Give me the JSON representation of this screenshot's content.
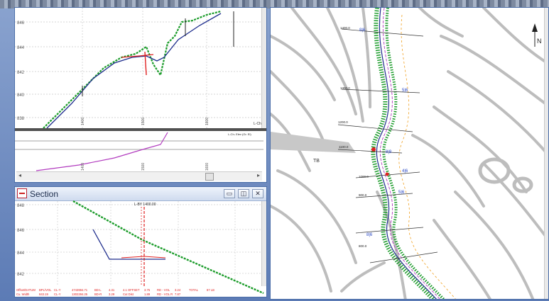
{
  "profile": {
    "elevation_ticks": [
      "846",
      "844",
      "842",
      "840",
      "838"
    ],
    "chainage_ticks": [
      "1400",
      "1500",
      "1600"
    ],
    "axis_tag": "L-Ch",
    "legend_text": "L-Ch- Elev (Gr. El)",
    "lower_ticks": [
      "1400",
      "1500",
      "1600"
    ]
  },
  "section": {
    "title": "Section",
    "elevation_ticks": [
      "848",
      "846",
      "844",
      "842"
    ],
    "chainage_label": "L-BY 1400.00",
    "footer_rows": [
      [
        "Offset/DATUM",
        "BPL/VOL",
        "CL-Y",
        "4743994.71",
        "BD-L",
        "4.31",
        "4.1 OFFSET",
        "3.75",
        "RD - VOL",
        "3.24",
        "TOTAL",
        "87 LB"
      ],
      [
        "Cu. Width",
        "843.19",
        "CL-Y",
        "1302284.25",
        "BD-R",
        "3.29",
        "Cut Dist",
        "1.89",
        "RD - VOL R",
        "7.87",
        "",
        ""
      ]
    ],
    "buttons": {
      "minimize": "▭",
      "restore": "◫",
      "close": "✕"
    }
  },
  "plan": {
    "north": "N",
    "label_tb": "TB",
    "station_labels": [
      "1400.0",
      "1300.0",
      "1200.0",
      "1100.0",
      "1000.0",
      "900.0",
      "800.0"
    ]
  },
  "colors": {
    "window_border": "#4b6ea8",
    "ground_line": "#1b9c2a",
    "design_line": "#1d2c8c",
    "contour": "#bdbdbd",
    "red_mark": "#e02020",
    "profile_magenta": "#b23cbf"
  }
}
